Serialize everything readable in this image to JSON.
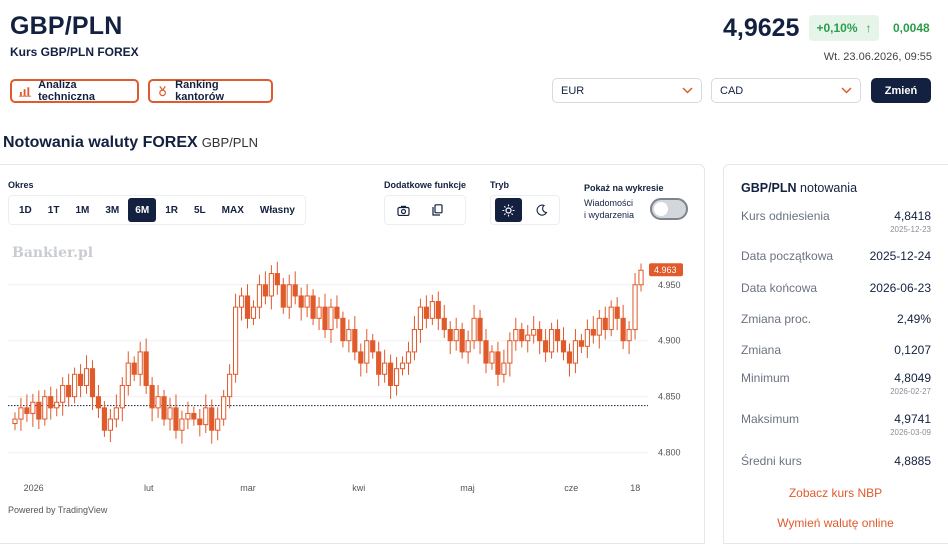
{
  "header": {
    "title": "GBP/PLN",
    "subtitle": "Kurs GBP/PLN FOREX",
    "price": "4,9625",
    "change_pct": "+0,10%",
    "change_abs": "0,0048",
    "datetime": "Wt. 23.06.2026, 09:55",
    "analysis_button": "Analiza techniczna",
    "ranking_button": "Ranking kantorów",
    "from_currency": "EUR",
    "to_currency": "CAD",
    "change_button": "Zmień"
  },
  "section": {
    "title": "Notowania waluty FOREX",
    "pair": "GBP/PLN"
  },
  "controls": {
    "period_label": "Okres",
    "periods": [
      "1D",
      "1T",
      "1M",
      "3M",
      "6M",
      "1R",
      "5L",
      "MAX",
      "Własny"
    ],
    "active_period": "6M",
    "extra_label": "Dodatkowe funkcje",
    "mode_label": "Tryb",
    "show_label": "Pokaż na wykresie",
    "news_label_1": "Wiadomości",
    "news_label_2": "i wydarzenia"
  },
  "watermark": "Bankier.pl",
  "powered_by": "Powered by TradingView",
  "chart_data": {
    "type": "candlestick",
    "x_tick_labels": [
      "2026",
      "lut",
      "mar",
      "kwi",
      "maj",
      "cze",
      "18"
    ],
    "y_tick_labels": [
      "4.950",
      "4.900",
      "4.850",
      "4.800"
    ],
    "ylim": [
      4.78,
      4.99
    ],
    "last_price_label": "4.963",
    "reference_line": 4.842,
    "close_series": [
      4.83,
      4.84,
      4.835,
      4.845,
      4.83,
      4.85,
      4.84,
      4.845,
      4.86,
      4.85,
      4.87,
      4.86,
      4.875,
      4.85,
      4.84,
      4.82,
      4.83,
      4.84,
      4.86,
      4.88,
      4.87,
      4.89,
      4.86,
      4.84,
      4.85,
      4.83,
      4.84,
      4.82,
      4.83,
      4.835,
      4.83,
      4.825,
      4.84,
      4.82,
      4.83,
      4.85,
      4.87,
      4.93,
      4.94,
      4.92,
      4.93,
      4.95,
      4.94,
      4.96,
      4.95,
      4.93,
      4.95,
      4.94,
      4.93,
      4.94,
      4.92,
      4.93,
      4.91,
      4.93,
      4.92,
      4.9,
      4.91,
      4.89,
      4.88,
      4.9,
      4.89,
      4.87,
      4.88,
      4.86,
      4.875,
      4.88,
      4.89,
      4.91,
      4.93,
      4.92,
      4.935,
      4.92,
      4.91,
      4.9,
      4.91,
      4.89,
      4.9,
      4.92,
      4.9,
      4.88,
      4.89,
      4.87,
      4.88,
      4.9,
      4.91,
      4.9,
      4.905,
      4.91,
      4.9,
      4.89,
      4.91,
      4.9,
      4.89,
      4.88,
      4.9,
      4.895,
      4.91,
      4.905,
      4.92,
      4.91,
      4.93,
      4.92,
      4.9,
      4.91,
      4.95,
      4.963
    ]
  },
  "stats": {
    "title_pair": "GBP/PLN",
    "title_word": "notowania",
    "rows": [
      {
        "label": "Kurs odniesienia",
        "value": "4,8418",
        "sub": "2025-12-23"
      },
      {
        "label": "Data początkowa",
        "value": "2025-12-24",
        "sub": ""
      },
      {
        "label": "Data końcowa",
        "value": "2026-06-23",
        "sub": ""
      },
      {
        "label": "Zmiana proc.",
        "value": "2,49%",
        "sub": ""
      },
      {
        "label": "Zmiana",
        "value": "0,1207",
        "sub": ""
      },
      {
        "label": "Minimum",
        "value": "4,8049",
        "sub": "2026-02-27"
      },
      {
        "label": "Maksimum",
        "value": "4,9741",
        "sub": "2026-03-09"
      },
      {
        "label": "Średni kurs",
        "value": "4,8885",
        "sub": ""
      }
    ],
    "link_nbp": "Zobacz kurs NBP",
    "link_exchange": "Wymień walutę online"
  },
  "colors": {
    "accent": "#e05a2b",
    "navy": "#13203f",
    "positive": "#2a9d4a"
  }
}
